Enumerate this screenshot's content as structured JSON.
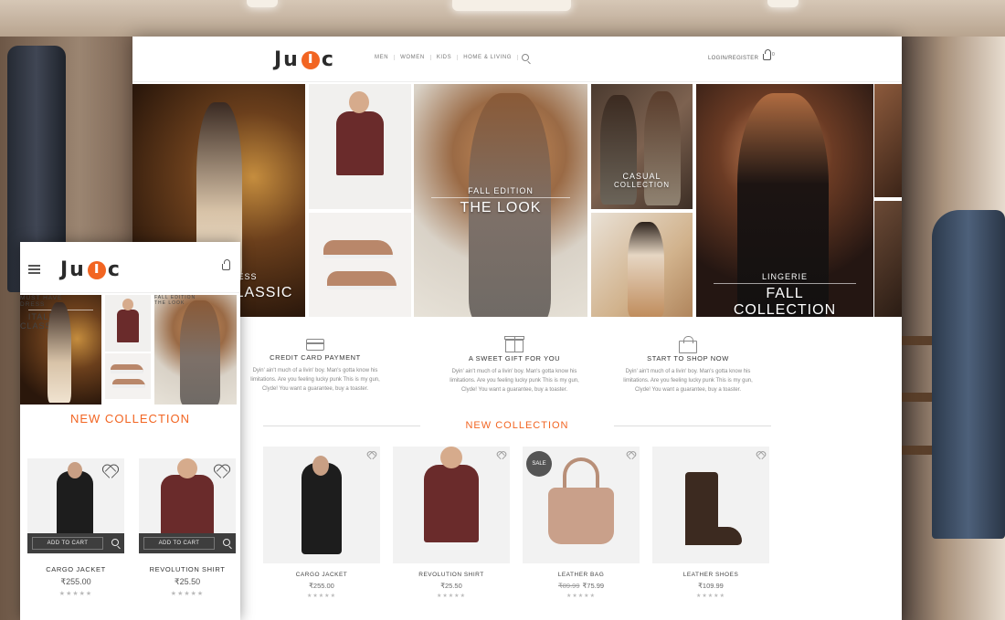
{
  "brand": {
    "logo_left": "Ju",
    "logo_right": "c",
    "accent": "#f26522"
  },
  "desktop": {
    "nav": [
      "MEN",
      "WOMEN",
      "KIDS",
      "HOME & LIVING"
    ],
    "login": "LOGIN/REGISTER",
    "cart_count": "0",
    "hero": {
      "city": {
        "big": "CLASSIC",
        "small": "RESS"
      },
      "look": {
        "small": "FALL EDITION",
        "big": "THE LOOK"
      },
      "casual": {
        "small": "CASUAL",
        "big": "COLLECTION"
      },
      "lingerie": {
        "small": "LINGERIE",
        "big": "FALL COLLECTION"
      }
    },
    "features": [
      {
        "title": "CREDIT CARD PAYMENT",
        "desc": "Dyin' ain't much of a livin' boy. Man's gotta know his limitations. Are you feeling lucky punk This is my gun, Clyde! You want a guarantee, buy a toaster."
      },
      {
        "title": "A SWEET GIFT FOR YOU",
        "desc": "Dyin' ain't much of a livin' boy. Man's gotta know his limitations. Are you feeling lucky punk This is my gun, Clyde! You want a guarantee, buy a toaster."
      },
      {
        "title": "START TO SHOP NOW",
        "desc": "Dyin' ain't much of a livin' boy. Man's gotta know his limitations. Are you feeling lucky punk This is my gun, Clyde! You want a guarantee, buy a toaster."
      }
    ],
    "section_title": "NEW COLLECTION",
    "products": [
      {
        "name": "CARGO JACKET",
        "price": "₹255.00"
      },
      {
        "name": "REVOLUTION SHIRT",
        "price": "₹25.50"
      },
      {
        "name": "LEATHER BAG",
        "old_price": "₹89.99",
        "price": "₹75.99",
        "badge": "SALE"
      },
      {
        "name": "LEATHER SHOES",
        "price": "₹109.99"
      }
    ],
    "stars": "★★★★★"
  },
  "mobile": {
    "hero": {
      "city": {
        "small1": "MUST HAVE",
        "small2": "DRESS",
        "big1": "ITALIAN",
        "big2": "CLASSIC"
      },
      "look": {
        "small": "FALL EDITION",
        "big": "THE LOOK"
      }
    },
    "section_title": "NEW COLLECTION",
    "add_to_cart": "ADD TO CART",
    "products": [
      {
        "name": "CARGO JACKET",
        "price": "₹255.00"
      },
      {
        "name": "REVOLUTION SHIRT",
        "price": "₹25.50"
      }
    ],
    "stars": "★★★★★"
  }
}
